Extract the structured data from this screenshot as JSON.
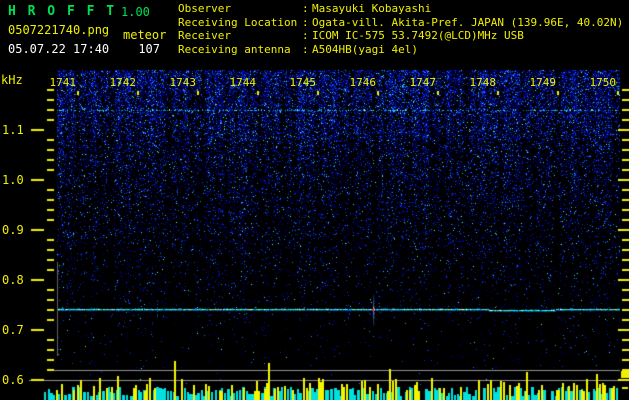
{
  "header": {
    "title": "H R O F F T",
    "version": "1.00",
    "filename": "0507221740.png",
    "mode_label": "meteor",
    "datetime": "05.07.22 17:40",
    "echo_count": "107",
    "colon": ":",
    "info_rows": [
      {
        "label": "Observer",
        "value": "Masayuki Kobayashi"
      },
      {
        "label": "Receiving Location",
        "value": "Ogata-vill. Akita-Pref. JAPAN (139.96E, 40.02N)"
      },
      {
        "label": "Receiver",
        "value": "ICOM IC-575 53.7492(@LCD)MHz USB"
      },
      {
        "label": "Receiving antenna",
        "value": "A504HB(yagi 4el)"
      }
    ]
  },
  "chart_data": {
    "type": "heatmap",
    "subtype": "radio-meteor-spectrogram",
    "title": "HROFFT 10-minute radio meteor spectrogram",
    "ylabel": "kHz",
    "y_tick_labels": [
      "1.1",
      "1.0",
      "0.9",
      "0.8",
      "0.7",
      "0.6"
    ],
    "y_tick_values_khz": [
      1.1,
      1.0,
      0.9,
      0.8,
      0.7,
      0.6
    ],
    "y_range_khz": [
      0.56,
      1.22
    ],
    "x_tick_labels": [
      "1741",
      "1742",
      "1743",
      "1744",
      "1745",
      "1746",
      "1747",
      "1748",
      "1749",
      "1750"
    ],
    "x_range_hhmm": [
      "1740",
      "1750"
    ],
    "grid": false,
    "legend": false,
    "series": [
      {
        "name": "carrier trace",
        "type": "line",
        "y_khz": 0.74,
        "description": "continuous horizontal carrier line across full 10-minute span, cyan/green with sporadic bright segments"
      },
      {
        "name": "meteor echo",
        "type": "event",
        "time_hhmm": "1745",
        "y_khz": 0.74,
        "description": "vertical Doppler-spread streak with red saturated core on the carrier line"
      },
      {
        "name": "minor echo",
        "type": "event",
        "time_hhmm": "1741.7",
        "y_khz": 0.74,
        "description": "faint short vertical streak on carrier line"
      }
    ],
    "background_noise": "dense blue speckle, densest at top (above ~1.0 kHz), fading to black below ~0.75 kHz, with vertical column banding",
    "scanline_khz": 1.14,
    "bottom_strip": {
      "description": "per-second signal-level bar meter along bottom edge",
      "bar_colors": [
        "#00e0e0",
        "#f5f500"
      ],
      "reference_lines_gray": 2
    },
    "colors": {
      "background": "#000000",
      "noise_blue": "#0000c8",
      "carrier_cyan": "#00e8ff",
      "tick_yellow": "#f0f000",
      "gray_line": "#909090",
      "title_green": "#00e050",
      "text_yellow": "#f0f000",
      "text_white": "#ffffff",
      "echo_red": "#ff2222"
    }
  }
}
